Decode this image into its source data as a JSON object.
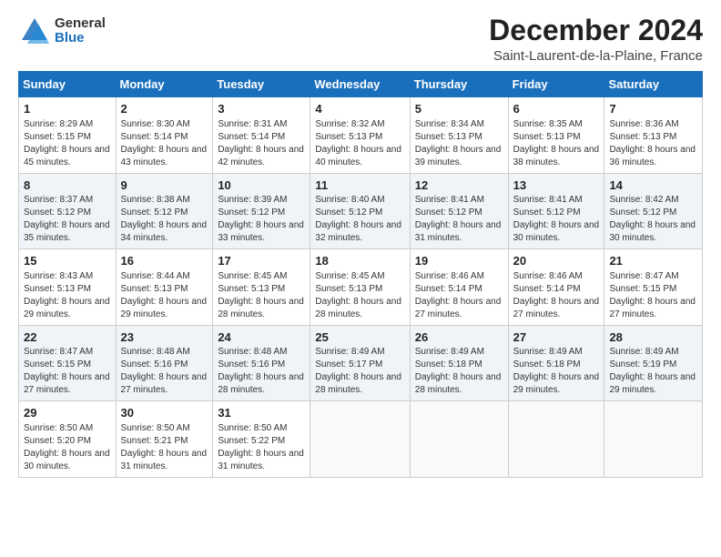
{
  "logo": {
    "general": "General",
    "blue": "Blue"
  },
  "title": "December 2024",
  "location": "Saint-Laurent-de-la-Plaine, France",
  "days_of_week": [
    "Sunday",
    "Monday",
    "Tuesday",
    "Wednesday",
    "Thursday",
    "Friday",
    "Saturday"
  ],
  "weeks": [
    [
      {
        "day": 1,
        "sunrise": "Sunrise: 8:29 AM",
        "sunset": "Sunset: 5:15 PM",
        "daylight": "Daylight: 8 hours and 45 minutes."
      },
      {
        "day": 2,
        "sunrise": "Sunrise: 8:30 AM",
        "sunset": "Sunset: 5:14 PM",
        "daylight": "Daylight: 8 hours and 43 minutes."
      },
      {
        "day": 3,
        "sunrise": "Sunrise: 8:31 AM",
        "sunset": "Sunset: 5:14 PM",
        "daylight": "Daylight: 8 hours and 42 minutes."
      },
      {
        "day": 4,
        "sunrise": "Sunrise: 8:32 AM",
        "sunset": "Sunset: 5:13 PM",
        "daylight": "Daylight: 8 hours and 40 minutes."
      },
      {
        "day": 5,
        "sunrise": "Sunrise: 8:34 AM",
        "sunset": "Sunset: 5:13 PM",
        "daylight": "Daylight: 8 hours and 39 minutes."
      },
      {
        "day": 6,
        "sunrise": "Sunrise: 8:35 AM",
        "sunset": "Sunset: 5:13 PM",
        "daylight": "Daylight: 8 hours and 38 minutes."
      },
      {
        "day": 7,
        "sunrise": "Sunrise: 8:36 AM",
        "sunset": "Sunset: 5:13 PM",
        "daylight": "Daylight: 8 hours and 36 minutes."
      }
    ],
    [
      {
        "day": 8,
        "sunrise": "Sunrise: 8:37 AM",
        "sunset": "Sunset: 5:12 PM",
        "daylight": "Daylight: 8 hours and 35 minutes."
      },
      {
        "day": 9,
        "sunrise": "Sunrise: 8:38 AM",
        "sunset": "Sunset: 5:12 PM",
        "daylight": "Daylight: 8 hours and 34 minutes."
      },
      {
        "day": 10,
        "sunrise": "Sunrise: 8:39 AM",
        "sunset": "Sunset: 5:12 PM",
        "daylight": "Daylight: 8 hours and 33 minutes."
      },
      {
        "day": 11,
        "sunrise": "Sunrise: 8:40 AM",
        "sunset": "Sunset: 5:12 PM",
        "daylight": "Daylight: 8 hours and 32 minutes."
      },
      {
        "day": 12,
        "sunrise": "Sunrise: 8:41 AM",
        "sunset": "Sunset: 5:12 PM",
        "daylight": "Daylight: 8 hours and 31 minutes."
      },
      {
        "day": 13,
        "sunrise": "Sunrise: 8:41 AM",
        "sunset": "Sunset: 5:12 PM",
        "daylight": "Daylight: 8 hours and 30 minutes."
      },
      {
        "day": 14,
        "sunrise": "Sunrise: 8:42 AM",
        "sunset": "Sunset: 5:12 PM",
        "daylight": "Daylight: 8 hours and 30 minutes."
      }
    ],
    [
      {
        "day": 15,
        "sunrise": "Sunrise: 8:43 AM",
        "sunset": "Sunset: 5:13 PM",
        "daylight": "Daylight: 8 hours and 29 minutes."
      },
      {
        "day": 16,
        "sunrise": "Sunrise: 8:44 AM",
        "sunset": "Sunset: 5:13 PM",
        "daylight": "Daylight: 8 hours and 29 minutes."
      },
      {
        "day": 17,
        "sunrise": "Sunrise: 8:45 AM",
        "sunset": "Sunset: 5:13 PM",
        "daylight": "Daylight: 8 hours and 28 minutes."
      },
      {
        "day": 18,
        "sunrise": "Sunrise: 8:45 AM",
        "sunset": "Sunset: 5:13 PM",
        "daylight": "Daylight: 8 hours and 28 minutes."
      },
      {
        "day": 19,
        "sunrise": "Sunrise: 8:46 AM",
        "sunset": "Sunset: 5:14 PM",
        "daylight": "Daylight: 8 hours and 27 minutes."
      },
      {
        "day": 20,
        "sunrise": "Sunrise: 8:46 AM",
        "sunset": "Sunset: 5:14 PM",
        "daylight": "Daylight: 8 hours and 27 minutes."
      },
      {
        "day": 21,
        "sunrise": "Sunrise: 8:47 AM",
        "sunset": "Sunset: 5:15 PM",
        "daylight": "Daylight: 8 hours and 27 minutes."
      }
    ],
    [
      {
        "day": 22,
        "sunrise": "Sunrise: 8:47 AM",
        "sunset": "Sunset: 5:15 PM",
        "daylight": "Daylight: 8 hours and 27 minutes."
      },
      {
        "day": 23,
        "sunrise": "Sunrise: 8:48 AM",
        "sunset": "Sunset: 5:16 PM",
        "daylight": "Daylight: 8 hours and 27 minutes."
      },
      {
        "day": 24,
        "sunrise": "Sunrise: 8:48 AM",
        "sunset": "Sunset: 5:16 PM",
        "daylight": "Daylight: 8 hours and 28 minutes."
      },
      {
        "day": 25,
        "sunrise": "Sunrise: 8:49 AM",
        "sunset": "Sunset: 5:17 PM",
        "daylight": "Daylight: 8 hours and 28 minutes."
      },
      {
        "day": 26,
        "sunrise": "Sunrise: 8:49 AM",
        "sunset": "Sunset: 5:18 PM",
        "daylight": "Daylight: 8 hours and 28 minutes."
      },
      {
        "day": 27,
        "sunrise": "Sunrise: 8:49 AM",
        "sunset": "Sunset: 5:18 PM",
        "daylight": "Daylight: 8 hours and 29 minutes."
      },
      {
        "day": 28,
        "sunrise": "Sunrise: 8:49 AM",
        "sunset": "Sunset: 5:19 PM",
        "daylight": "Daylight: 8 hours and 29 minutes."
      }
    ],
    [
      {
        "day": 29,
        "sunrise": "Sunrise: 8:50 AM",
        "sunset": "Sunset: 5:20 PM",
        "daylight": "Daylight: 8 hours and 30 minutes."
      },
      {
        "day": 30,
        "sunrise": "Sunrise: 8:50 AM",
        "sunset": "Sunset: 5:21 PM",
        "daylight": "Daylight: 8 hours and 31 minutes."
      },
      {
        "day": 31,
        "sunrise": "Sunrise: 8:50 AM",
        "sunset": "Sunset: 5:22 PM",
        "daylight": "Daylight: 8 hours and 31 minutes."
      },
      null,
      null,
      null,
      null
    ]
  ]
}
